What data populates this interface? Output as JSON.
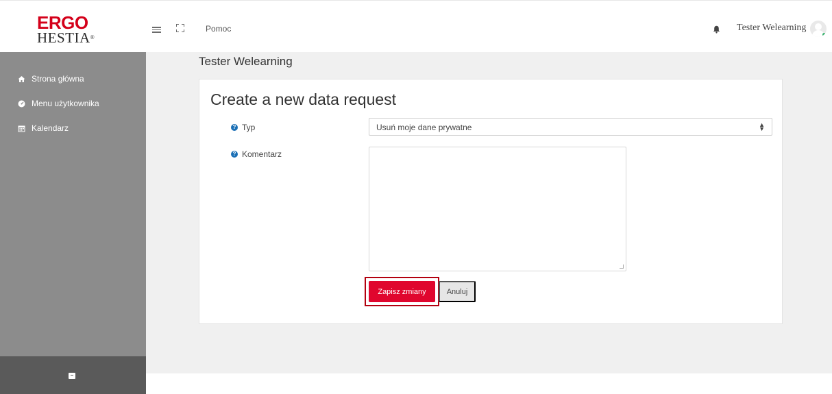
{
  "brand": {
    "line1": "ERGO",
    "line2": "HESTIA",
    "mark": "®"
  },
  "header": {
    "help_label": "Pomoc",
    "user_name": "Tester Welearning",
    "menu_icon": "hamburger-icon",
    "fullscreen_icon": "expand-icon",
    "notifications_icon": "bell-icon",
    "online_color": "#3cb371"
  },
  "sidebar": {
    "items": [
      {
        "label": "Strona główna",
        "icon": "home-icon"
      },
      {
        "label": "Menu użytkownika",
        "icon": "dashboard-icon"
      },
      {
        "label": "Kalendarz",
        "icon": "calendar-icon"
      }
    ],
    "bottom_icon": "archive-icon"
  },
  "main": {
    "page_heading": "Tester Welearning",
    "form_title": "Create a new data request",
    "fields": {
      "type_label": "Typ",
      "type_value": "Usuń moje dane prywatne",
      "comment_label": "Komentarz",
      "comment_value": ""
    },
    "buttons": {
      "save_label": "Zapisz zmiany",
      "cancel_label": "Anuluj"
    }
  },
  "colors": {
    "brand_red": "#d4001a",
    "primary_button": "#e0062e",
    "highlight_border": "#b3000f",
    "sidebar": "#8c8c8c",
    "help_icon": "#1a6fb5"
  }
}
